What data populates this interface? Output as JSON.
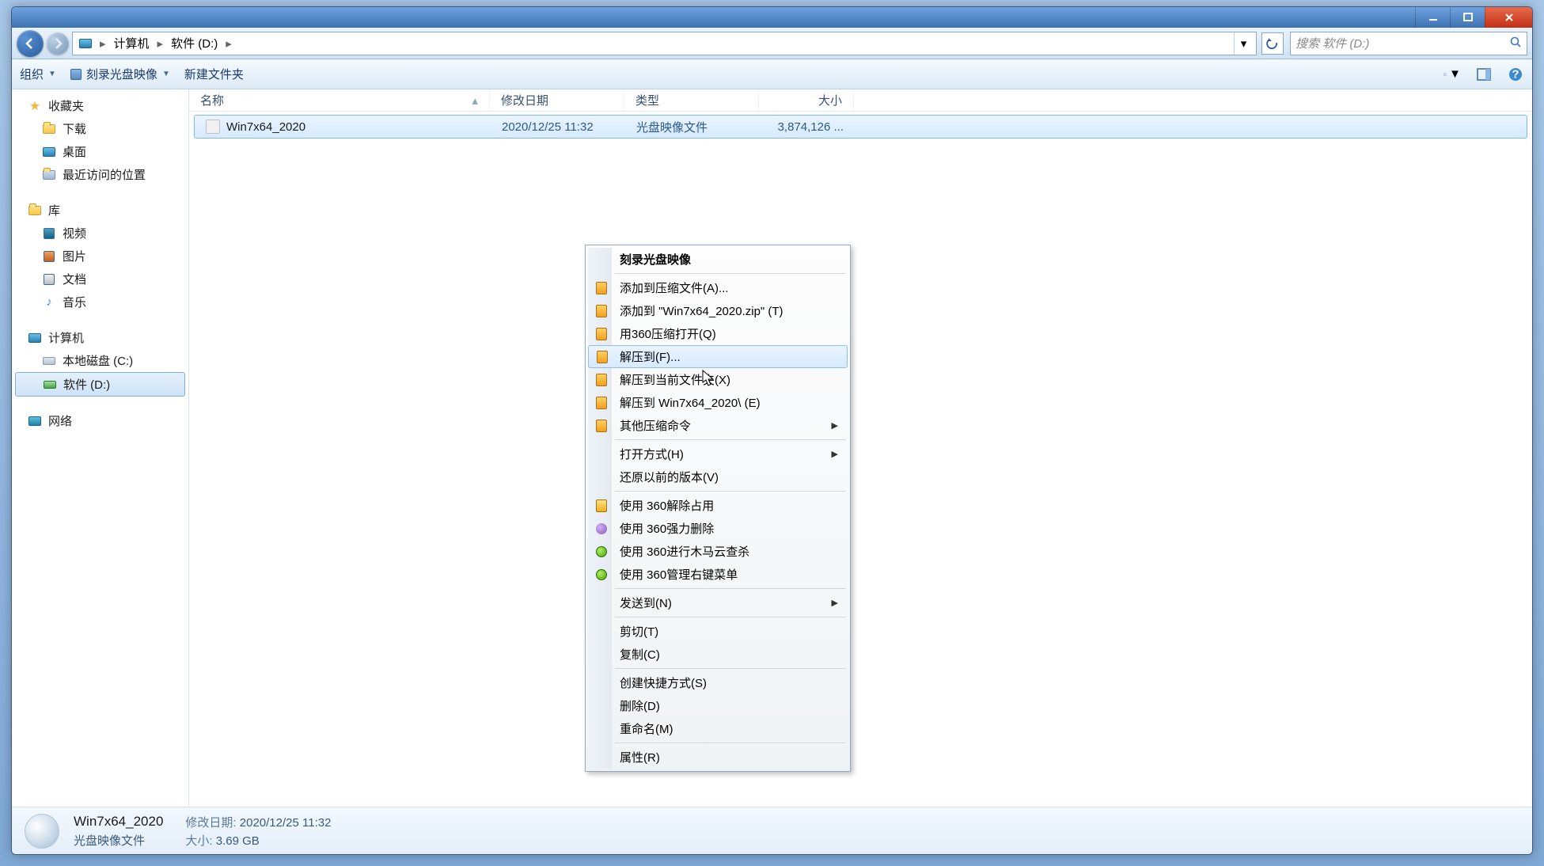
{
  "breadcrumb": {
    "root": "计算机",
    "current": "软件 (D:)"
  },
  "search": {
    "placeholder": "搜索 软件 (D:)"
  },
  "toolbar": {
    "organize": "组织",
    "burn": "刻录光盘映像",
    "newfolder": "新建文件夹"
  },
  "columns": {
    "name": "名称",
    "date": "修改日期",
    "type": "类型",
    "size": "大小"
  },
  "sidebar": {
    "favorites": {
      "head": "收藏夹",
      "items": [
        "下载",
        "桌面",
        "最近访问的位置"
      ]
    },
    "libraries": {
      "head": "库",
      "items": [
        "视频",
        "图片",
        "文档",
        "音乐"
      ]
    },
    "computer": {
      "head": "计算机",
      "items": [
        "本地磁盘 (C:)",
        "软件 (D:)"
      ]
    },
    "network": {
      "head": "网络"
    }
  },
  "file": {
    "name": "Win7x64_2020",
    "date": "2020/12/25 11:32",
    "type": "光盘映像文件",
    "size": "3,874,126 ..."
  },
  "details": {
    "name": "Win7x64_2020",
    "type": "光盘映像文件",
    "date_lbl": "修改日期:",
    "date": "2020/12/25 11:32",
    "size_lbl": "大小:",
    "size": "3.69 GB"
  },
  "ctx": {
    "burn": "刻录光盘映像",
    "addArchive": "添加到压缩文件(A)...",
    "addZip": "添加到 \"Win7x64_2020.zip\" (T)",
    "open360": "用360压缩打开(Q)",
    "extractTo": "解压到(F)...",
    "extractHere": "解压到当前文件夹(X)",
    "extractFolder": "解压到 Win7x64_2020\\ (E)",
    "otherZip": "其他压缩命令",
    "openWith": "打开方式(H)",
    "restore": "还原以前的版本(V)",
    "unlock360": "使用 360解除占用",
    "forceDel360": "使用 360强力删除",
    "scan360": "使用 360进行木马云查杀",
    "ctx360": "使用 360管理右键菜单",
    "sendTo": "发送到(N)",
    "cut": "剪切(T)",
    "copy": "复制(C)",
    "shortcut": "创建快捷方式(S)",
    "delete": "删除(D)",
    "rename": "重命名(M)",
    "props": "属性(R)"
  }
}
